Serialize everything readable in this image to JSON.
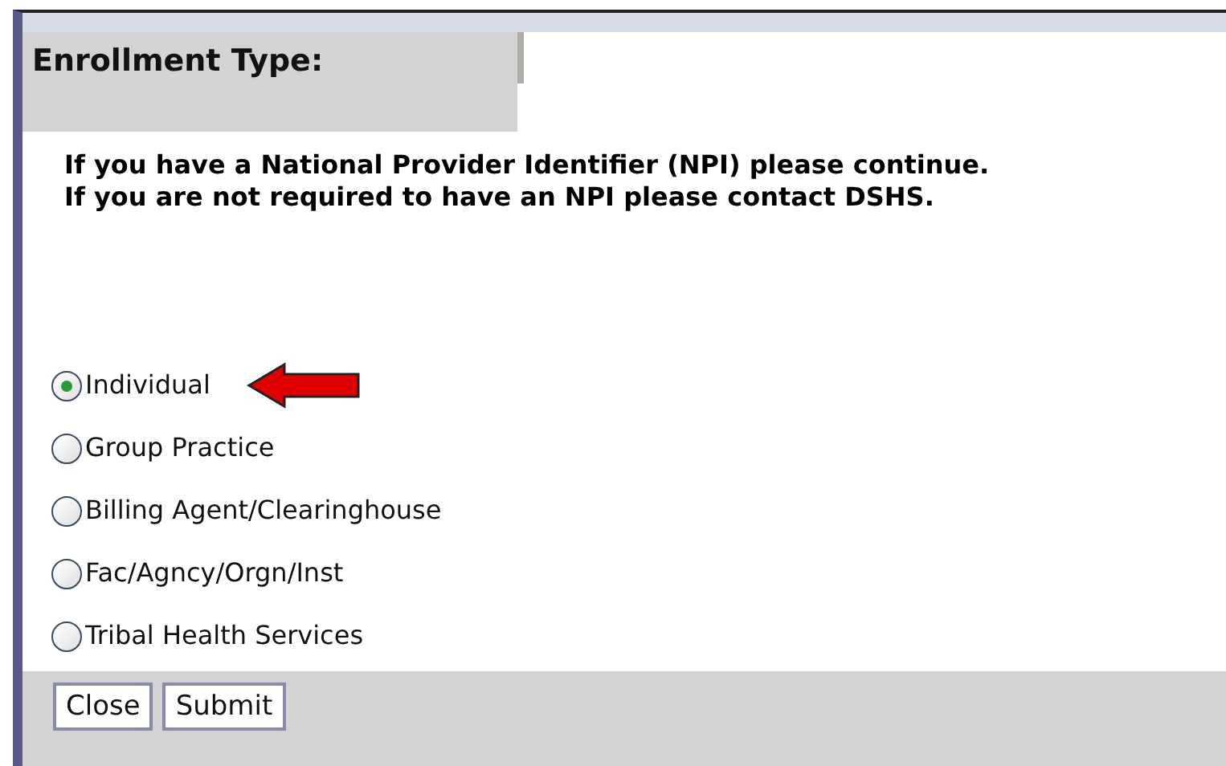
{
  "section": {
    "title": "Enrollment Type:"
  },
  "instructions": [
    "If you have a National Provider Identifier (NPI) please continue.",
    "If you are not required to have an NPI please contact DSHS."
  ],
  "options": [
    {
      "label": "Individual",
      "selected": true,
      "annotated": true
    },
    {
      "label": "Group Practice",
      "selected": false,
      "annotated": false
    },
    {
      "label": "Billing Agent/Clearinghouse",
      "selected": false,
      "annotated": false
    },
    {
      "label": "Fac/Agncy/Orgn/Inst",
      "selected": false,
      "annotated": false
    },
    {
      "label": "Tribal Health Services",
      "selected": false,
      "annotated": false
    }
  ],
  "buttons": [
    "Close",
    "Submit"
  ]
}
